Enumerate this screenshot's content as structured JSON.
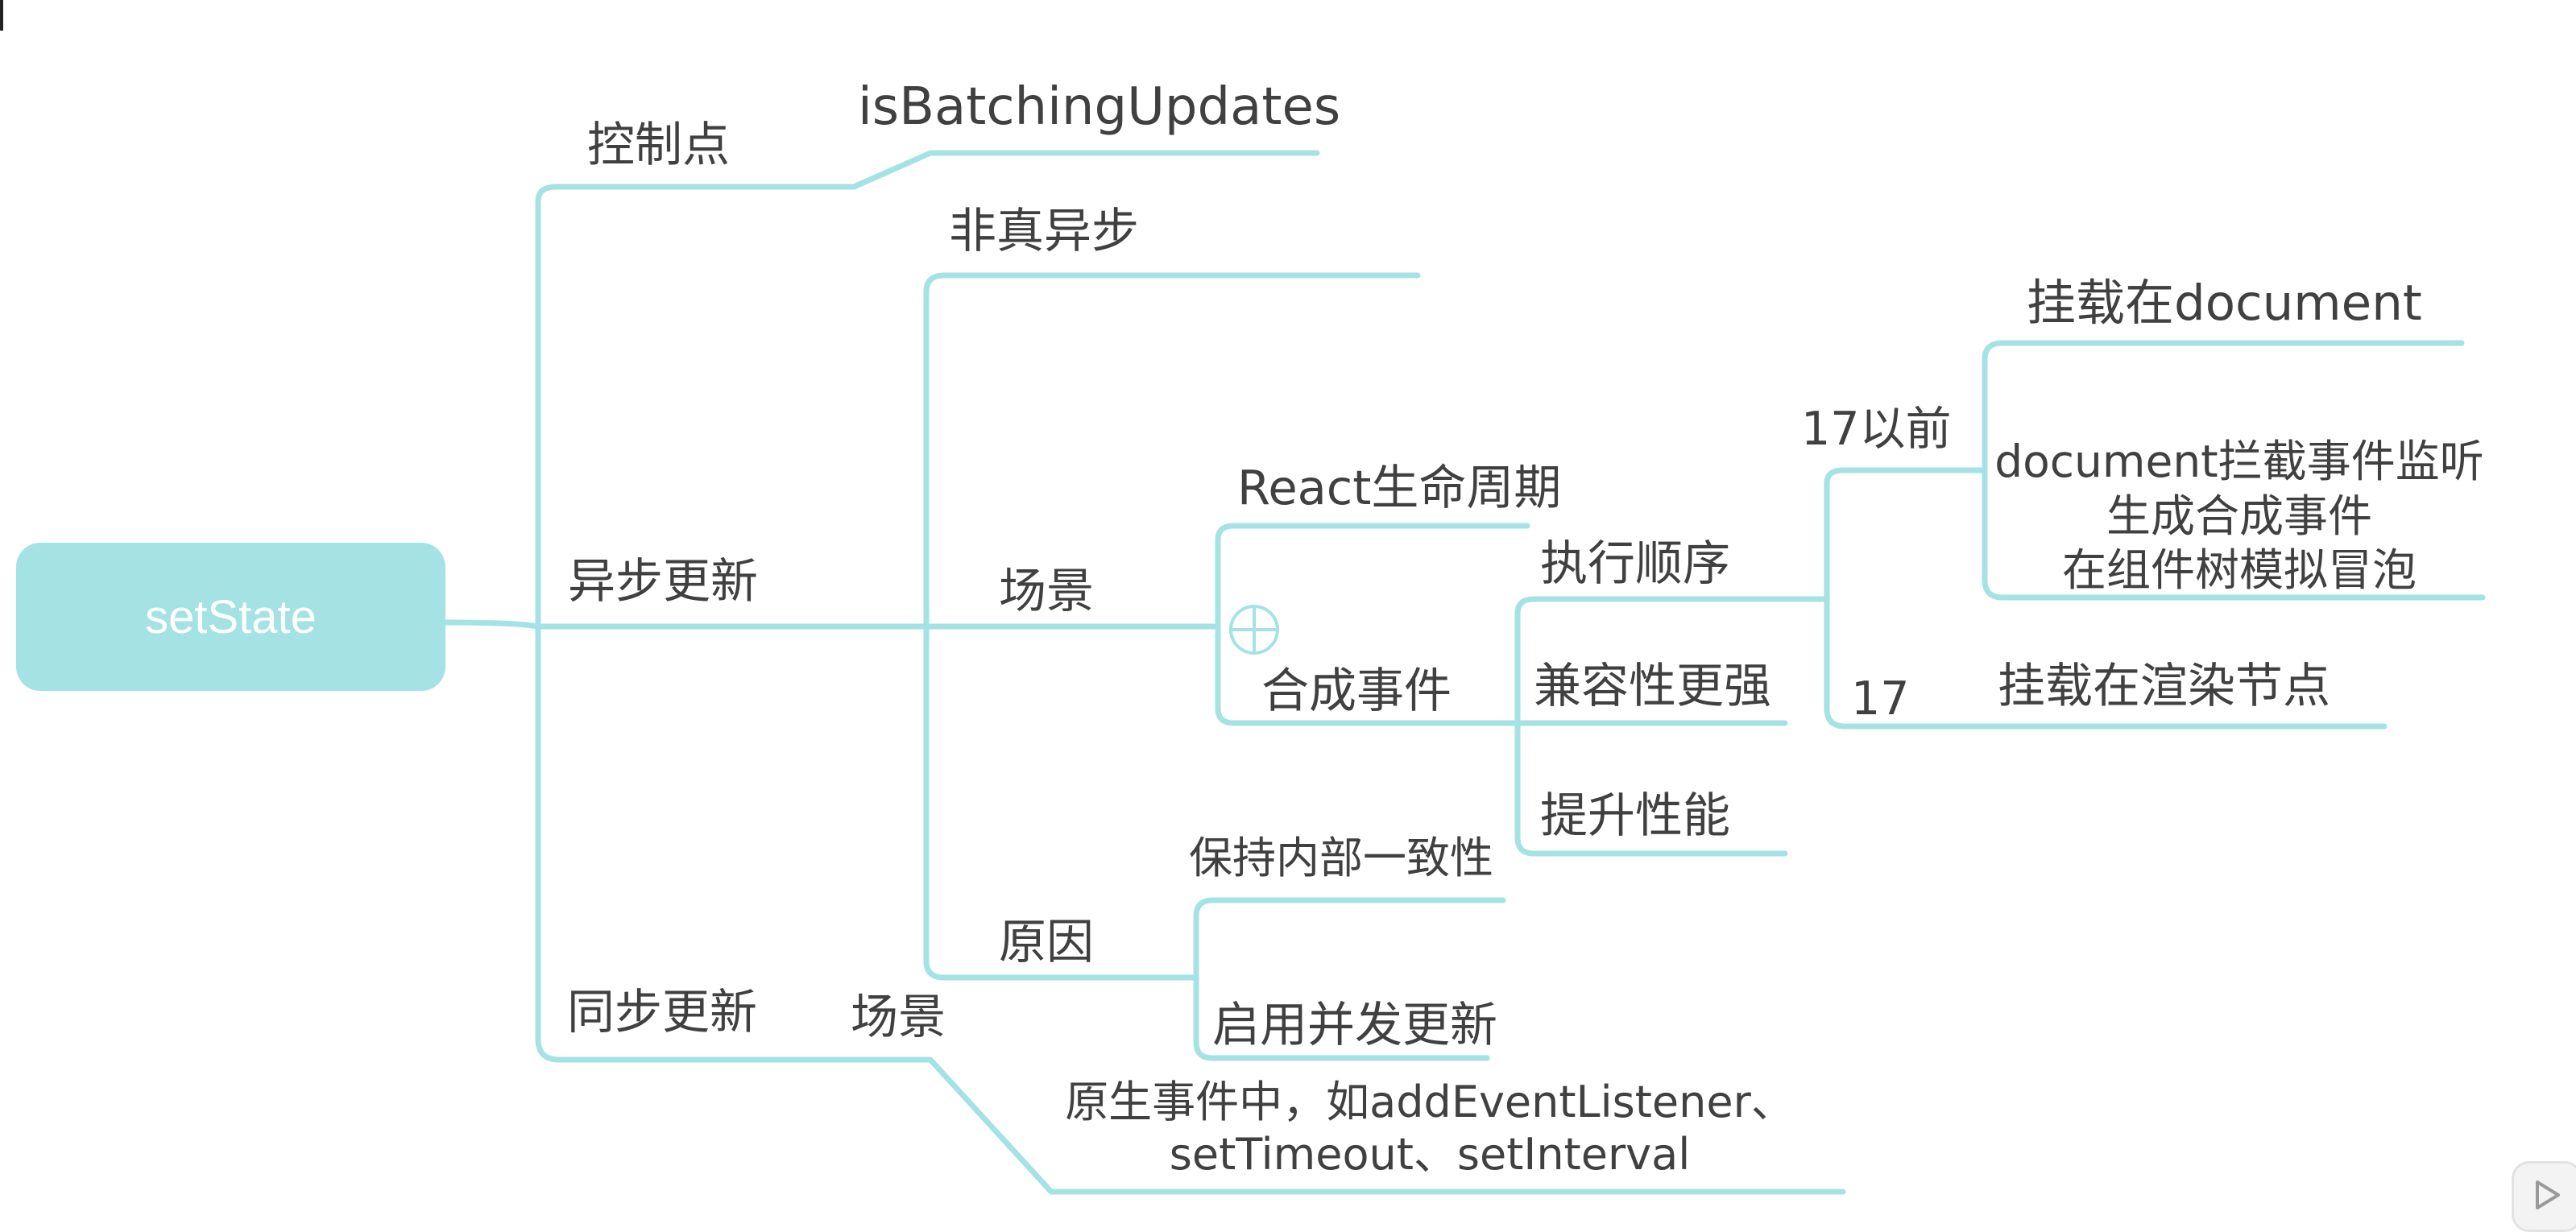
{
  "root": {
    "label": "setState"
  },
  "nodes": {
    "control_point": "控制点",
    "is_batching": "isBatchingUpdates",
    "async_update": "异步更新",
    "not_truly_async": "非真异步",
    "async_scene": "场景",
    "react_lifecycle": "React生命周期",
    "synthetic_event": "合成事件",
    "exec_order": "执行顺序",
    "before_17": "17以前",
    "mount_document": "挂载在document",
    "document_intercept_1": "document拦截事件监听",
    "document_intercept_2": "生成合成事件",
    "document_intercept_3": "在组件树模拟冒泡",
    "v17": "17",
    "mount_render_node": "挂载在渲染节点",
    "better_compat": "兼容性更强",
    "perf_boost": "提升性能",
    "reason": "原因",
    "keep_consistency": "保持内部一致性",
    "enable_concurrent": "启用并发更新",
    "sync_update": "同步更新",
    "sync_scene": "场景",
    "native_events_1": "原生事件中，如addEventListener、",
    "native_events_2": "setTimeout、setInterval"
  },
  "icons": {
    "expand": "plus-circle-icon",
    "corner": "play-icon"
  },
  "colors": {
    "branch": "#a5e2e4",
    "root_fill": "#a5e2e4",
    "text": "#404040",
    "root_text": "#ffffff"
  }
}
